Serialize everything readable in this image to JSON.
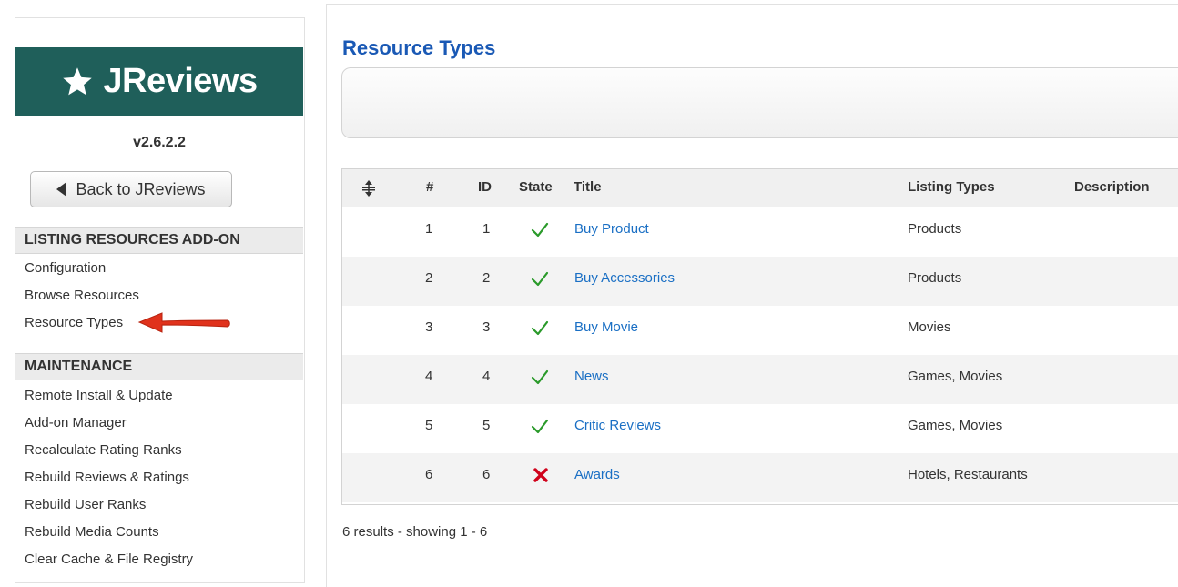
{
  "sidebar": {
    "logo_text": "JReviews",
    "version": "v2.6.2.2",
    "back_button": "Back to JReviews",
    "section1": {
      "title": "LISTING RESOURCES ADD-ON",
      "items": [
        "Configuration",
        "Browse Resources",
        "Resource Types"
      ]
    },
    "section2": {
      "title": "MAINTENANCE",
      "items": [
        "Remote Install & Update",
        "Add-on Manager",
        "Recalculate Rating Ranks",
        "Rebuild Reviews & Ratings",
        "Rebuild User Ranks",
        "Rebuild Media Counts",
        "Clear Cache & File Registry"
      ]
    }
  },
  "main": {
    "title": "Resource Types",
    "columns": {
      "num": "#",
      "id": "ID",
      "state": "State",
      "title": "Title",
      "listing_types": "Listing Types",
      "description": "Description"
    },
    "rows": [
      {
        "num": "1",
        "id": "1",
        "state": "published",
        "title": "Buy Product",
        "listing_types": "Products"
      },
      {
        "num": "2",
        "id": "2",
        "state": "published",
        "title": "Buy Accessories",
        "listing_types": "Products"
      },
      {
        "num": "3",
        "id": "3",
        "state": "published",
        "title": "Buy Movie",
        "listing_types": "Movies"
      },
      {
        "num": "4",
        "id": "4",
        "state": "published",
        "title": "News",
        "listing_types": "Games, Movies"
      },
      {
        "num": "5",
        "id": "5",
        "state": "published",
        "title": "Critic Reviews",
        "listing_types": "Games, Movies"
      },
      {
        "num": "6",
        "id": "6",
        "state": "unpublished",
        "title": "Awards",
        "listing_types": "Hotels, Restaurants"
      }
    ],
    "results_text": "6 results - showing 1 - 6"
  },
  "colors": {
    "brand": "#1f5f5a",
    "title_blue": "#1a59b5",
    "link_blue": "#1a6fc4",
    "check_green": "#2a9a2a",
    "cross_red": "#d0021b",
    "arrow_red": "#e0321c"
  }
}
